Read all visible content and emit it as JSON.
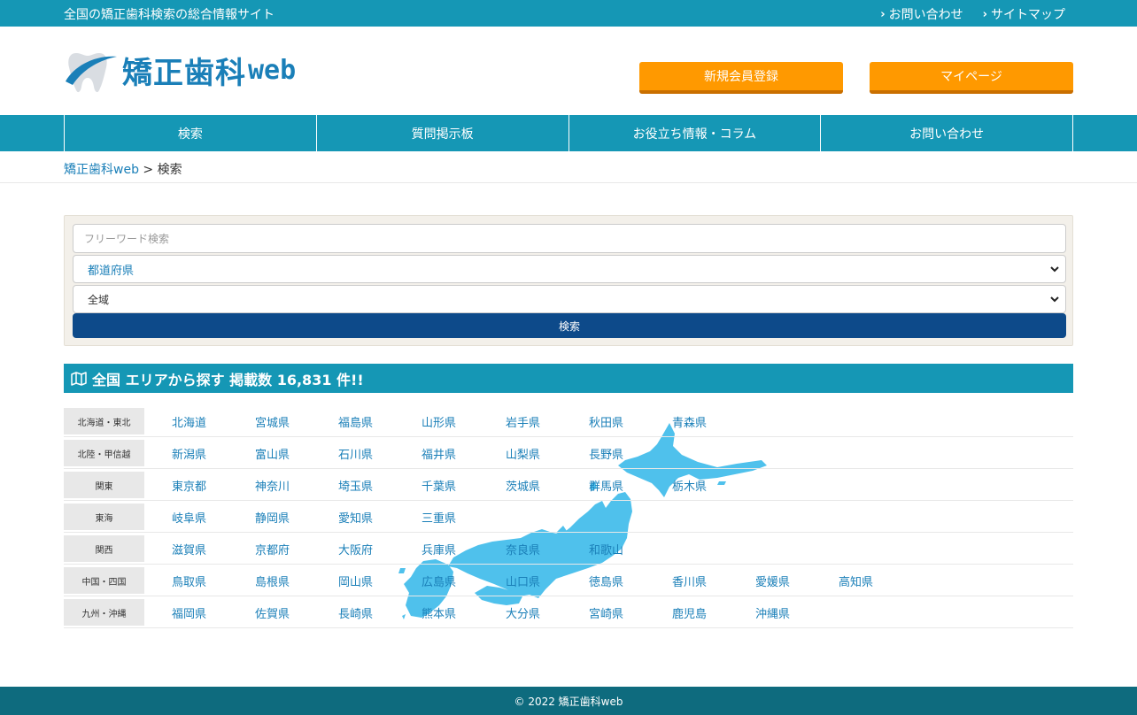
{
  "topbar": {
    "tagline": "全国の矯正歯科検索の総合情報サイト",
    "links": [
      "お問い合わせ",
      "サイトマップ"
    ]
  },
  "header": {
    "logo_text": "矯正歯科",
    "logo_web": "web",
    "register_label": "新規会員登録",
    "mypage_label": "マイページ"
  },
  "nav": {
    "items": [
      "検索",
      "質問掲示板",
      "お役立ち情報・コラム",
      "お問い合わせ"
    ]
  },
  "breadcrumb": {
    "home": "矯正歯科web",
    "separator": " > ",
    "current": "検索"
  },
  "search": {
    "freeword_placeholder": "フリーワード検索",
    "prefecture_selected": "都道府県",
    "area_selected": "全域",
    "button_label": "検索"
  },
  "area_section": {
    "title": "全国 エリアから探す 掲載数 16,831 件!!"
  },
  "regions": [
    {
      "label": "北海道・東北",
      "prefs": [
        "北海道",
        "宮城県",
        "福島県",
        "山形県",
        "岩手県",
        "秋田県",
        "青森県"
      ]
    },
    {
      "label": "北陸・甲信越",
      "prefs": [
        "新潟県",
        "富山県",
        "石川県",
        "福井県",
        "山梨県",
        "長野県"
      ]
    },
    {
      "label": "関東",
      "prefs": [
        "東京都",
        "神奈川",
        "埼玉県",
        "千葉県",
        "茨城県",
        "群馬県",
        "栃木県"
      ]
    },
    {
      "label": "東海",
      "prefs": [
        "岐阜県",
        "静岡県",
        "愛知県",
        "三重県"
      ]
    },
    {
      "label": "関西",
      "prefs": [
        "滋賀県",
        "京都府",
        "大阪府",
        "兵庫県",
        "奈良県",
        "和歌山"
      ]
    },
    {
      "label": "中国・四国",
      "prefs": [
        "鳥取県",
        "島根県",
        "岡山県",
        "広島県",
        "山口県",
        "徳島県",
        "香川県",
        "愛媛県",
        "高知県"
      ]
    },
    {
      "label": "九州・沖縄",
      "prefs": [
        "福岡県",
        "佐賀県",
        "長崎県",
        "熊本県",
        "大分県",
        "宮崎県",
        "鹿児島",
        "沖縄県"
      ]
    }
  ],
  "footer": {
    "copyright": "© 2022 矯正歯科web"
  },
  "colors": {
    "primary": "#1597b5",
    "accent_orange": "#ff9900",
    "search_button": "#0d4a8a",
    "footer": "#0e6b7e",
    "link": "#1a7fb8",
    "map_fill": "#4fc1ec"
  }
}
